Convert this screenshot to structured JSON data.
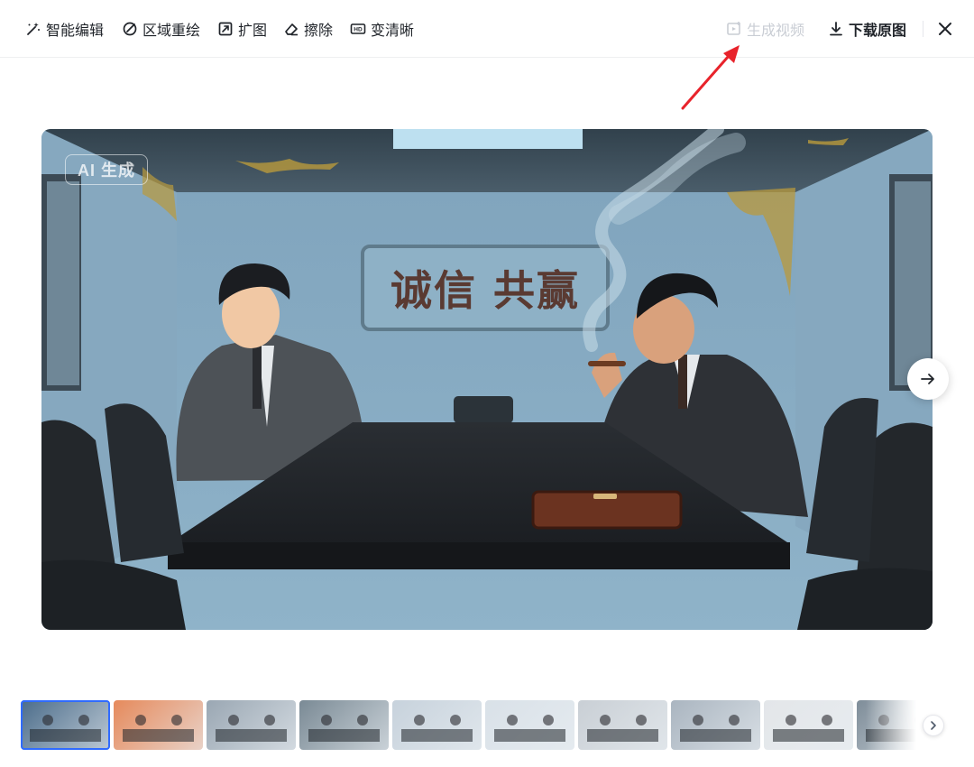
{
  "toolbar": {
    "smart_edit": "智能编辑",
    "region_redraw": "区域重绘",
    "expand": "扩图",
    "erase": "擦除",
    "sharpen": "变清晰",
    "generate_video": "生成视频",
    "download_original": "下载原图"
  },
  "image": {
    "badge": "AI 生成",
    "poster_text": "诚信 共赢"
  },
  "colors": {
    "accent": "#2f6bff",
    "annotation_arrow": "#e8232b",
    "disabled_text": "#c9cdd4"
  },
  "thumbnails": [
    {
      "active": true,
      "accent": "#4b6c8a"
    },
    {
      "active": false,
      "accent": "#e68a5c"
    },
    {
      "active": false,
      "accent": "#9aa7b3"
    },
    {
      "active": false,
      "accent": "#7a8a95"
    },
    {
      "active": false,
      "accent": "#c7d2dc"
    },
    {
      "active": false,
      "accent": "#d9e1e8"
    },
    {
      "active": false,
      "accent": "#c9cfd5"
    },
    {
      "active": false,
      "accent": "#aab5c0"
    },
    {
      "active": false,
      "accent": "#e3e6e9"
    },
    {
      "active": false,
      "accent": "#7e8d99"
    }
  ]
}
